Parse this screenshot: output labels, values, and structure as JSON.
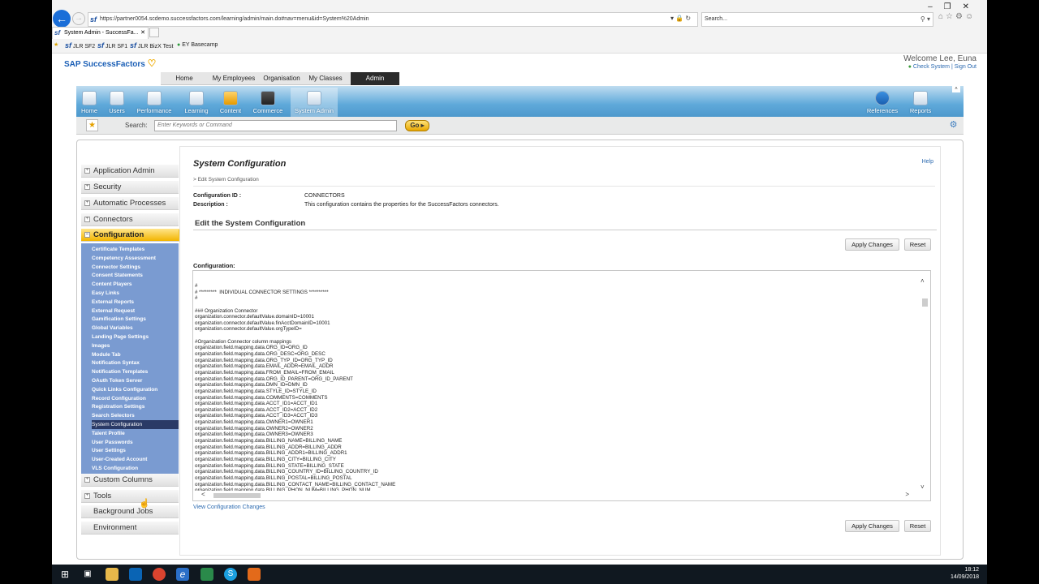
{
  "browser": {
    "url": "https://partner0054.scdemo.successfactors.com/learning/admin/main.do#nav=menu&id=System%20Admin",
    "search_placeholder": "Search...",
    "tab_title": "System Admin - SuccessFa...",
    "favorites": [
      "JLR SF2",
      "JLR SF1",
      "JLR BizX Test",
      "EY Basecamp"
    ]
  },
  "header": {
    "logo": "SAP SuccessFactors",
    "welcome": "Welcome Lee, Euna",
    "check_system": "Check System",
    "sign_out": "Sign Out",
    "link_sep": "|"
  },
  "topnav": [
    "Home",
    "My Employees",
    "Organisation",
    "My Classes",
    "Admin"
  ],
  "iconbar": {
    "left": [
      "Home",
      "Users",
      "Performance",
      "Learning",
      "Content",
      "Commerce",
      "System Admin"
    ],
    "right": [
      "References",
      "Reports"
    ]
  },
  "searchbar": {
    "label": "Search:",
    "placeholder": "Enter Keywords or Command",
    "go": "Go"
  },
  "leftnav": {
    "top_items": [
      "Application Admin",
      "Security",
      "Automatic Processes",
      "Connectors"
    ],
    "active_group": "Configuration",
    "sub_items": [
      "Certificate Templates",
      "Competency Assessment",
      "Connector Settings",
      "Consent Statements",
      "Content Players",
      "Easy Links",
      "External Reports",
      "External Request",
      "Gamification Settings",
      "Global Variables",
      "Landing Page Settings",
      "Images",
      "Module Tab",
      "Notification Syntax",
      "Notification Templates",
      "OAuth Token Server",
      "Quick Links Configuration",
      "Record Configuration",
      "Registration Settings",
      "Search Selectors",
      "System Configuration",
      "Talent Profile",
      "User Passwords",
      "User Settings",
      "User-Created Account",
      "VLS Configuration"
    ],
    "active_sub": "System Configuration",
    "bottom_items": [
      "Custom Columns",
      "Tools",
      "Background Jobs",
      "Environment"
    ]
  },
  "content": {
    "title": "System Configuration",
    "help": "Help",
    "breadcrumb": "> Edit System Configuration",
    "config_id_label": "Configuration ID :",
    "config_id": "CONNECTORS",
    "description_label": "Description :",
    "description": "This configuration contains the properties for the SuccessFactors connectors.",
    "edit_title": "Edit the System Configuration",
    "apply": "Apply Changes",
    "reset": "Reset",
    "config_label": "Configuration:",
    "config_text": "#\n# *********  INDIVIDUAL CONNECTOR SETTINGS **********\n#\n\n### Organization Connector\norganization.connector.defaultValue.domainID=10001\norganization.connector.defaultValue.finAcctDomainID=10001\norganization.connector.defaultValue.orgTypeID=\n\n#Organization Connector column mappings\norganization.field.mapping.data.ORG_ID=ORG_ID\norganization.field.mapping.data.ORG_DESC=ORG_DESC\norganization.field.mapping.data.ORG_TYP_ID=ORG_TYP_ID\norganization.field.mapping.data.EMAIL_ADDR=EMAIL_ADDR\norganization.field.mapping.data.FROM_EMAIL=FROM_EMAIL\norganization.field.mapping.data.ORG_ID_PARENT=ORG_ID_PARENT\norganization.field.mapping.data.DMN_ID=DMN_ID\norganization.field.mapping.data.STYLE_ID=STYLE_ID\norganization.field.mapping.data.COMMENTS=COMMENTS\norganization.field.mapping.data.ACCT_ID1=ACCT_ID1\norganization.field.mapping.data.ACCT_ID2=ACCT_ID2\norganization.field.mapping.data.ACCT_ID3=ACCT_ID3\norganization.field.mapping.data.OWNER1=OWNER1\norganization.field.mapping.data.OWNER2=OWNER2\norganization.field.mapping.data.OWNER3=OWNER3\norganization.field.mapping.data.BILLING_NAME=BILLING_NAME\norganization.field.mapping.data.BILLING_ADDR=BILLING_ADDR\norganization.field.mapping.data.BILLING_ADDR1=BILLING_ADDR1\norganization.field.mapping.data.BILLING_CITY=BILLING_CITY\norganization.field.mapping.data.BILLING_STATE=BILLING_STATE\norganization.field.mapping.data.BILLING_COUNTRY_ID=BILLING_COUNTRY_ID\norganization.field.mapping.data.BILLING_POSTAL=BILLING_POSTAL\norganization.field.mapping.data.BILLING_CONTACT_NAME=BILLING_CONTACT_NAME\norganization.field.mapping.data.BILLING_PHON_NUM=BILLING_PHON_NUM",
    "view_changes": "View Configuration Changes"
  },
  "taskbar": {
    "time": "18:12",
    "date": "14/09/2018"
  }
}
